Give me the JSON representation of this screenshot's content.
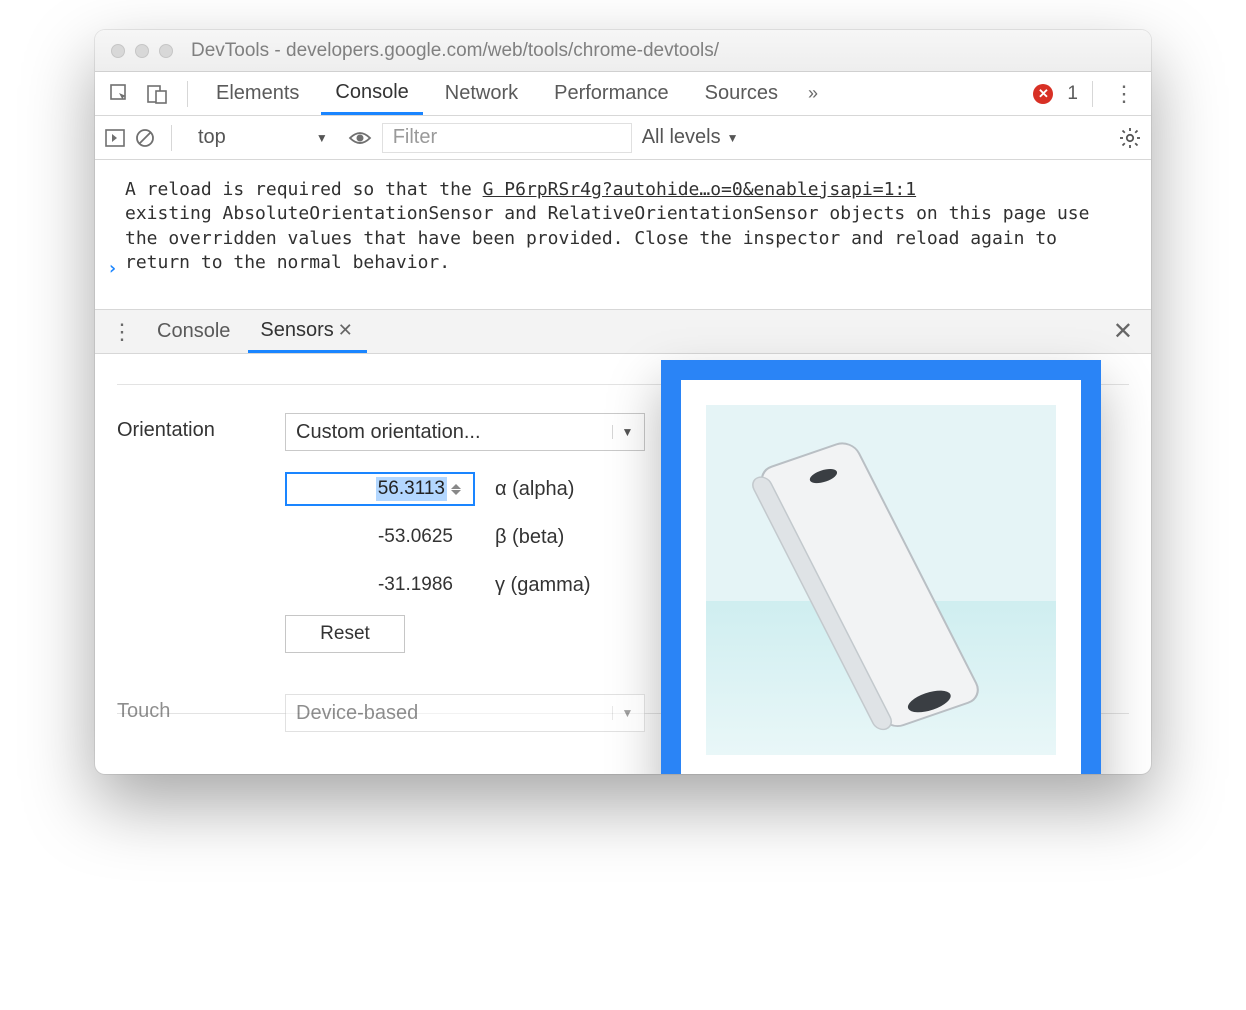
{
  "window": {
    "title": "DevTools - developers.google.com/web/tools/chrome-devtools/"
  },
  "tabs": {
    "items": [
      "Elements",
      "Console",
      "Network",
      "Performance",
      "Sources"
    ],
    "active": "Console",
    "more_glyph": "»",
    "error_count": "1"
  },
  "toolbar": {
    "context": "top",
    "filter_placeholder": "Filter",
    "levels_label": "All levels"
  },
  "console": {
    "message_pre": "A reload is required so that the ",
    "message_link": "G P6rpRSr4g?autohide…o=0&enablejsapi=1:1",
    "message_post": "\nexisting AbsoluteOrientationSensor and RelativeOrientationSensor objects on this page use the overridden values that have been provided. Close the inspector and reload again to return to the normal behavior.",
    "prompt": "›"
  },
  "drawer": {
    "tabs": [
      "Console",
      "Sensors"
    ],
    "active": "Sensors"
  },
  "sensors": {
    "section_label": "Orientation",
    "preset_label": "Custom orientation...",
    "fields": {
      "alpha": {
        "value": "56.3113",
        "label": "α (alpha)"
      },
      "beta": {
        "value": "-53.0625",
        "label": "β (beta)"
      },
      "gamma": {
        "value": "-31.1986",
        "label": "γ (gamma)"
      }
    },
    "reset_label": "Reset",
    "touch_label": "Touch",
    "touch_value": "Device-based"
  }
}
